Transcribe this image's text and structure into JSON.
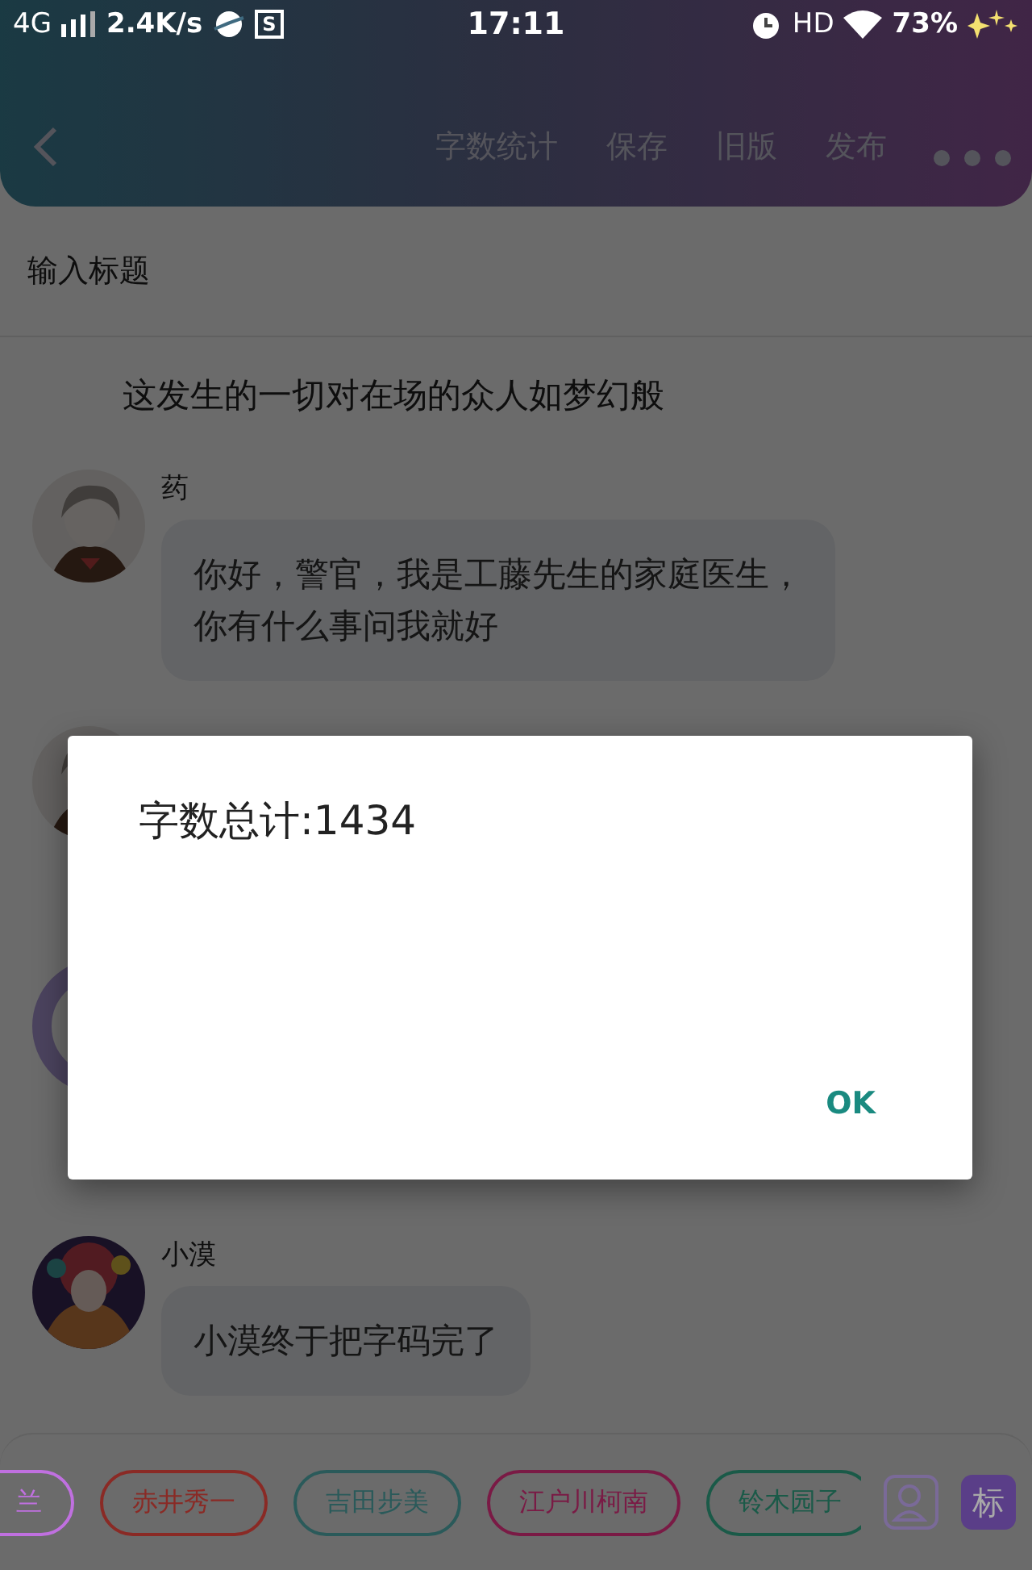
{
  "status_bar": {
    "network": "4G",
    "speed": "2.4K/s",
    "app_badge": "S",
    "time": "17:11",
    "hd": "HD",
    "battery": "73%"
  },
  "header": {
    "actions": [
      "字数统计",
      "保存",
      "旧版",
      "发布"
    ]
  },
  "title_field": {
    "placeholder": "输入标题"
  },
  "narration": "这发生的一切对在场的众人如梦幻般",
  "messages": [
    {
      "kind": "text",
      "name": "药",
      "lines": [
        "你好，警官，我是工藤先生的家庭医生，",
        "你有什么事问我就好"
      ]
    },
    {
      "kind": "hidden"
    },
    {
      "kind": "text",
      "name": "小漠",
      "lines": [
        "小漠终于把字码完了"
      ]
    }
  ],
  "dialog": {
    "message": "字数总计:1434",
    "button": "OK"
  },
  "characters": [
    {
      "name": "兰",
      "color": "#c070e0"
    },
    {
      "name": "赤井秀一",
      "color": "#8a2a25"
    },
    {
      "name": "吉田步美",
      "color": "#2a5a5a"
    },
    {
      "name": "江户川柯南",
      "color": "#7a1a45"
    },
    {
      "name": "铃木园子",
      "color": "#1a5a48"
    }
  ],
  "tag_button": "标"
}
